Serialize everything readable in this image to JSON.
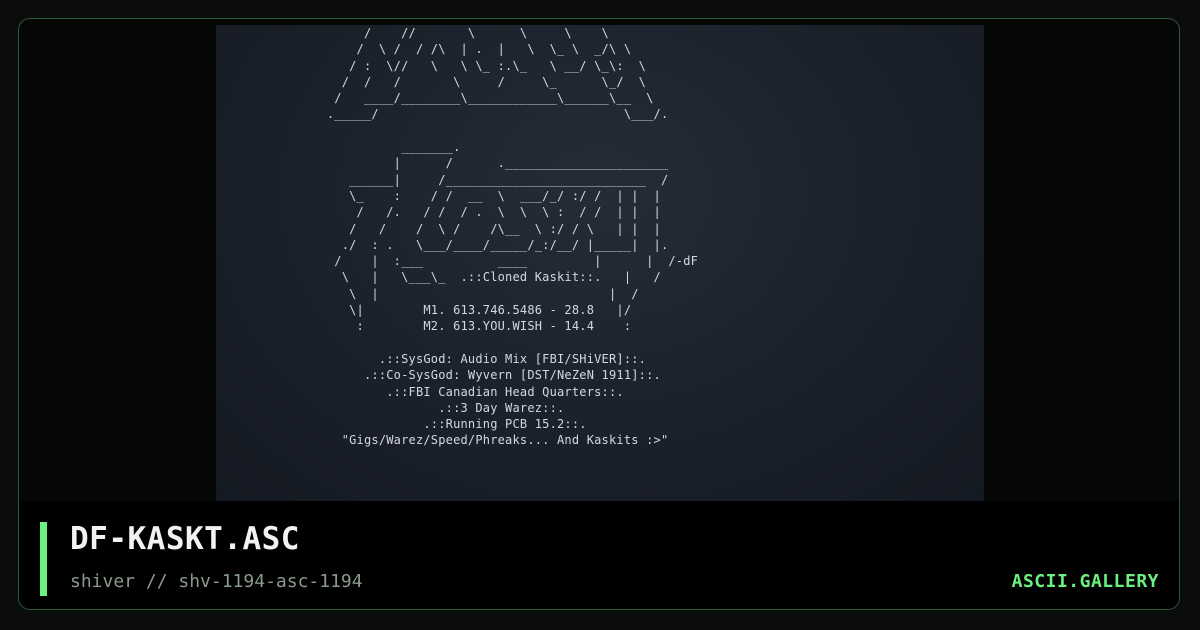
{
  "art": {
    "lines": [
      "       /    //       \\      \\     \\    \\",
      "      /  \\ /  / /\\  | .  |   \\  \\_ \\  _/\\ \\",
      "     / :  \\//   \\   \\ \\_ :.\\_   \\ __/ \\_\\:  \\",
      "    /  /   /       \\     /     \\_      \\_/  \\",
      "   /   ____/________\\____________\\______\\__  \\",
      "  ._____/                                 \\___/.",
      "",
      "            _______.",
      "           |      /      .______________________",
      "     ______|     /___________________________  /",
      "     \\_    :    / /  __  \\  ___/_/ :/ /  | |  |",
      "      /   /.   / /  / .  \\  \\  \\ :  / /  | |  |",
      "     /   /    /  \\ /    /\\__  \\ :/ / \\   | |  |",
      "    ./  : .   \\___/____/_____/_:/__/ |_____|  |.",
      "   /    |  :___          ____         |      |  /-dF",
      "    \\   |   \\___\\_  .::Cloned Kaskit::.   |   /",
      "     \\  |                               |  /",
      "     \\|        M1. 613.746.5486 - 28.8   |/",
      "      :        M2. 613.YOU.WISH - 14.4    :",
      "",
      "         .::SysGod: Audio Mix [FBI/SHiVER]::.",
      "       .::Co-SysGod: Wyvern [DST/NeZeN 1911]::.",
      "          .::FBI Canadian Head Quarters::.",
      "                 .::3 Day Warez::.",
      "               .::Running PCB 15.2::.",
      "    \"Gigs/Warez/Speed/Phreaks... And Kaskits :>\""
    ]
  },
  "footer": {
    "title": "DF-KASKT.ASC",
    "subtitle": "shiver // shv-1194-asc-1194",
    "brand": "ASCII.GALLERY"
  },
  "colors": {
    "accent": "#6cf07e",
    "background": "#000000",
    "border": "#2c5a34"
  }
}
